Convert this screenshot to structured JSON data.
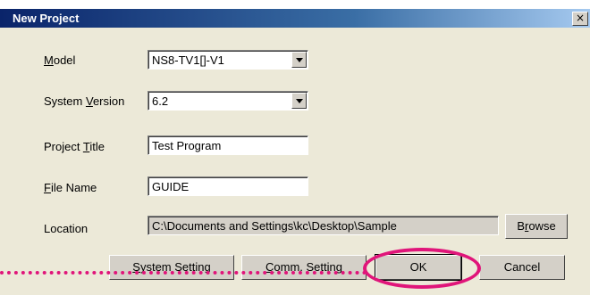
{
  "window": {
    "title": "New Project",
    "close_glyph": "×"
  },
  "form": {
    "model": {
      "label_pre": "",
      "label_ul": "M",
      "label_post": "odel",
      "value": "NS8-TV1[]-V1"
    },
    "system_version": {
      "label_pre": "System ",
      "label_ul": "V",
      "label_post": "ersion",
      "value": "6.2"
    },
    "project_title": {
      "label_pre": "Project ",
      "label_ul": "T",
      "label_post": "itle",
      "value": "Test Program"
    },
    "file_name": {
      "label_pre": "",
      "label_ul": "F",
      "label_post": "ile Name",
      "value": "GUIDE"
    },
    "location": {
      "label": "Location",
      "value": "C:\\Documents and Settings\\kc\\Desktop\\Sample"
    }
  },
  "buttons": {
    "browse": {
      "pre": "B",
      "ul": "r",
      "post": "owse"
    },
    "system_setting": {
      "pre": "",
      "ul": "S",
      "post": "ystem Setting"
    },
    "comm_setting": {
      "pre": "",
      "ul": "C",
      "post": "omm. Setting"
    },
    "ok": "OK",
    "cancel": "Cancel"
  },
  "annotation": {
    "highlight_color": "#e0157a"
  }
}
